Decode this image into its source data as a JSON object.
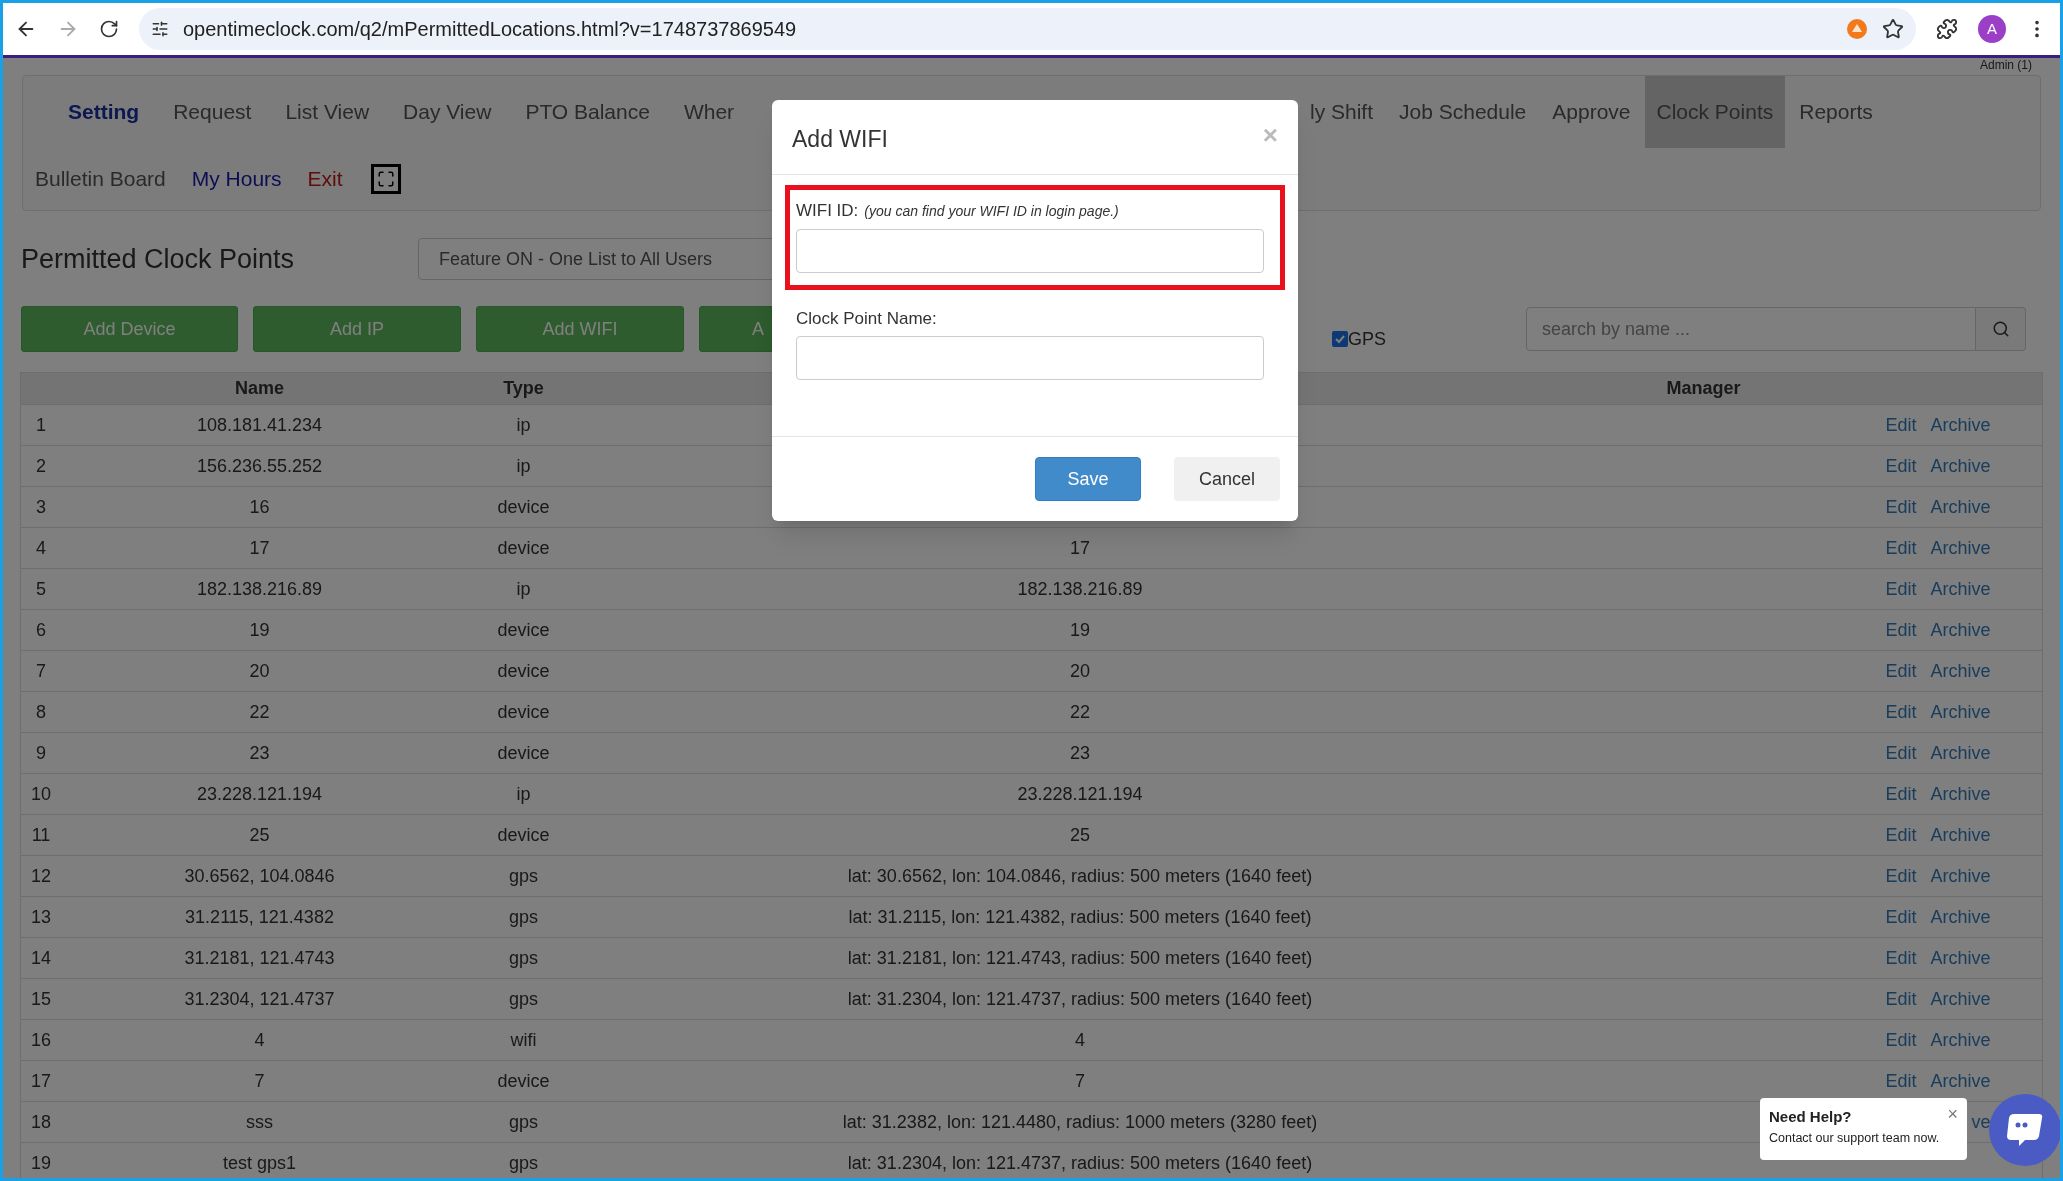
{
  "browser": {
    "url": "opentimeclock.com/q2/mPermittedLocations.html?v=1748737869549",
    "avatar": "A"
  },
  "account": "Admin (1)",
  "nav": {
    "row_1_left": [
      {
        "label": "Setting",
        "kind": "brand",
        "selected": false
      },
      {
        "label": "Request",
        "kind": "link",
        "selected": false
      },
      {
        "label": "List View",
        "kind": "link",
        "selected": false
      },
      {
        "label": "Day View",
        "kind": "link",
        "selected": false
      },
      {
        "label": "PTO Balance",
        "kind": "link",
        "selected": false
      },
      {
        "label": "Wher",
        "kind": "link",
        "selected": false
      }
    ],
    "row_1_right": [
      {
        "label": "ly Shift",
        "kind": "link",
        "selected": false
      },
      {
        "label": "Job Schedule",
        "kind": "link",
        "selected": false
      },
      {
        "label": "Approve",
        "kind": "link",
        "selected": false
      },
      {
        "label": "Clock Points",
        "kind": "link",
        "selected": true
      },
      {
        "label": "Reports",
        "kind": "link",
        "selected": false
      }
    ],
    "row_2": [
      {
        "label": "Bulletin Board",
        "kind": "link",
        "selected": false
      },
      {
        "label": "My Hours",
        "kind": "highlight",
        "selected": false
      },
      {
        "label": "Exit",
        "kind": "danger",
        "selected": false
      }
    ]
  },
  "page_title": "Permitted Clock Points",
  "mode_select": {
    "value": "Feature ON - One List to All Users"
  },
  "buttons": [
    "Add Device",
    "Add IP",
    "Add WIFI",
    "A"
  ],
  "gps_filter": {
    "label": "GPS",
    "checked": true
  },
  "search": {
    "placeholder": "search by name ..."
  },
  "table": {
    "columns": [
      "Name",
      "Type",
      "Manager"
    ],
    "rows": [
      {
        "number": "1",
        "name": "108.181.41.234",
        "type": "ip",
        "edit": "Edit",
        "archive": "Archive"
      },
      {
        "number": "2",
        "name": "156.236.55.252",
        "type": "ip",
        "edit": "Edit",
        "archive": "Archive"
      },
      {
        "number": "3",
        "name": "16",
        "type": "device",
        "edit": "Edit",
        "archive": "Archive"
      },
      {
        "number": "4",
        "name": "17",
        "type": "device",
        "column_3": "17",
        "edit": "Edit",
        "archive": "Archive"
      },
      {
        "number": "5",
        "name": "182.138.216.89",
        "type": "ip",
        "column_3": "182.138.216.89",
        "edit": "Edit",
        "archive": "Archive"
      },
      {
        "number": "6",
        "name": "19",
        "type": "device",
        "column_3": "19",
        "edit": "Edit",
        "archive": "Archive"
      },
      {
        "number": "7",
        "name": "20",
        "type": "device",
        "column_3": "20",
        "edit": "Edit",
        "archive": "Archive"
      },
      {
        "number": "8",
        "name": "22",
        "type": "device",
        "column_3": "22",
        "edit": "Edit",
        "archive": "Archive"
      },
      {
        "number": "9",
        "name": "23",
        "type": "device",
        "column_3": "23",
        "edit": "Edit",
        "archive": "Archive"
      },
      {
        "number": "10",
        "name": "23.228.121.194",
        "type": "ip",
        "column_3": "23.228.121.194",
        "edit": "Edit",
        "archive": "Archive"
      },
      {
        "number": "11",
        "name": "25",
        "type": "device",
        "column_3": "25",
        "edit": "Edit",
        "archive": "Archive"
      },
      {
        "number": "12",
        "name": "30.6562, 104.0846",
        "type": "gps",
        "column_3": "lat: 30.6562, lon: 104.0846, radius: 500 meters (1640 feet)",
        "edit": "Edit",
        "archive": "Archive"
      },
      {
        "number": "13",
        "name": "31.2115, 121.4382",
        "type": "gps",
        "column_3": "lat: 31.2115, lon: 121.4382, radius: 500 meters (1640 feet)",
        "edit": "Edit",
        "archive": "Archive"
      },
      {
        "number": "14",
        "name": "31.2181, 121.4743",
        "type": "gps",
        "column_3": "lat: 31.2181, lon: 121.4743, radius: 500 meters (1640 feet)",
        "edit": "Edit",
        "archive": "Archive"
      },
      {
        "number": "15",
        "name": "31.2304, 121.4737",
        "type": "gps",
        "column_3": "lat: 31.2304, lon: 121.4737, radius: 500 meters (1640 feet)",
        "edit": "Edit",
        "archive": "Archive"
      },
      {
        "number": "16",
        "name": "4",
        "type": "wifi",
        "column_3": "4",
        "edit": "Edit",
        "archive": "Archive"
      },
      {
        "number": "17",
        "name": "7",
        "type": "device",
        "column_3": "7",
        "edit": "Edit",
        "archive": "Archive"
      },
      {
        "number": "18",
        "name": "sss",
        "type": "gps",
        "column_3": "lat: 31.2382, lon: 121.4480, radius: 1000 meters (3280 feet)",
        "archive": "ve"
      },
      {
        "number": "19",
        "name": "test gps1",
        "type": "gps",
        "column_3": "lat: 31.2304, lon: 121.4737, radius: 500 meters (1640 feet)"
      }
    ]
  },
  "dialog": {
    "title": "Add WIFI",
    "close": "×",
    "wifi_id": {
      "label": "WIFI ID:",
      "hint": "(you can find your WIFI ID in login page.)",
      "highlighted": true
    },
    "clock_point_name": {
      "label": "Clock Point Name:"
    },
    "save": "Save",
    "cancel": "Cancel"
  },
  "help_popup": {
    "title": "Need Help?",
    "text": "Contact our support team now.",
    "close": "×"
  }
}
